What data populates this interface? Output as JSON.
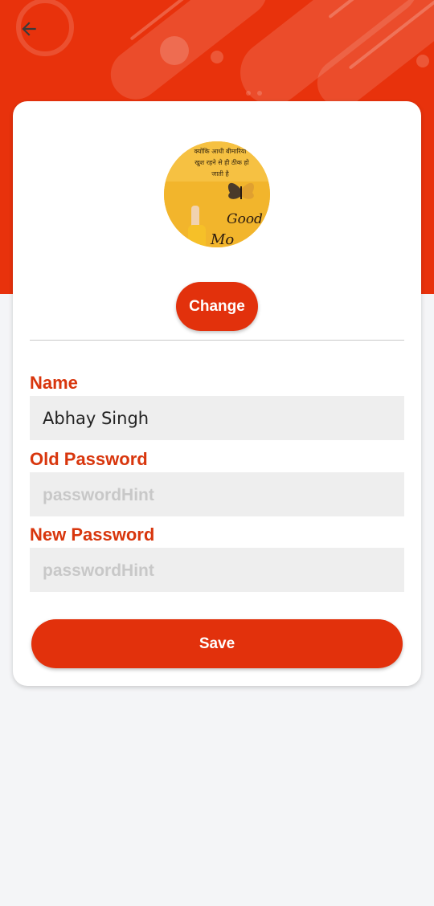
{
  "theme": {
    "accent": "#e2310c",
    "header_bg": "#e8320c",
    "page_bg": "#f4f5f7",
    "label_color": "#d8360d",
    "input_bg": "#eeeeee"
  },
  "header": {
    "back_icon": "arrow-left-icon"
  },
  "profile": {
    "avatar_alt": "profile-photo",
    "avatar_text": {
      "line1": "क्योंकि आधी बीमारियां",
      "line2": "खुश रहने से ही ठीक हो",
      "line3": "जाती है",
      "greeting1": "Good",
      "greeting2": "Mo"
    },
    "change_label": "Change"
  },
  "form": {
    "name": {
      "label": "Name",
      "value": "Abhay Singh"
    },
    "old_password": {
      "label": "Old Password",
      "placeholder": "passwordHint",
      "value": ""
    },
    "new_password": {
      "label": "New Password",
      "placeholder": "passwordHint",
      "value": ""
    },
    "save_label": "Save"
  }
}
